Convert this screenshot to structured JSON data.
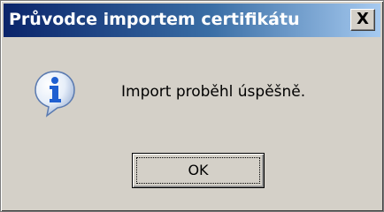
{
  "window": {
    "title": "Průvodce importem certifikátu",
    "close_label": "X"
  },
  "dialog": {
    "icon": "information-icon",
    "message": "Import proběhl úspěšně.",
    "ok_label": "OK"
  },
  "colors": {
    "titlebar_start": "#0a246a",
    "titlebar_end": "#a6caf0",
    "dialog_bg": "#d4d0c8",
    "icon_blue": "#1f5fd1"
  }
}
